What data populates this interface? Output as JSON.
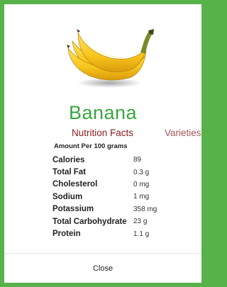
{
  "fruit": {
    "name": "Banana",
    "image_icon": "banana-bunch-image"
  },
  "tabs": {
    "nutrition_facts": "Nutrition Facts",
    "varieties": "Varieties"
  },
  "amount_per": "Amount Per 100 grams",
  "facts": [
    {
      "name": "Calories",
      "value": "89"
    },
    {
      "name": "Total Fat",
      "value": "0.3 g"
    },
    {
      "name": "Cholesterol",
      "value": "0 mg"
    },
    {
      "name": "Sodium",
      "value": "1 mg"
    },
    {
      "name": "Potassium",
      "value": "358 mg"
    },
    {
      "name": "Total Carbohydrate",
      "value": "23 g"
    },
    {
      "name": "Protein",
      "value": "1.1 g"
    }
  ],
  "close_label": "Close",
  "colors": {
    "background_green": "#57b349",
    "title_green": "#3aa63f",
    "tab_active": "#8b1a1a",
    "tab_inactive": "#a8565a"
  }
}
